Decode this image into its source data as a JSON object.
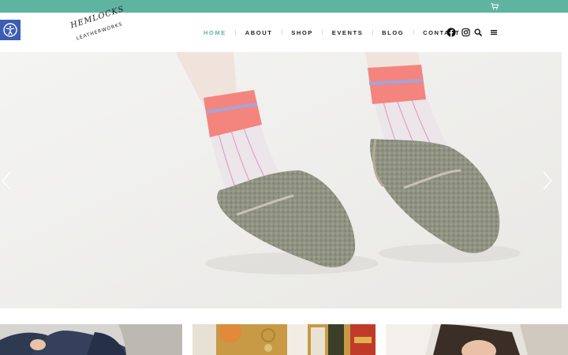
{
  "brand": {
    "logo_line1": "HEMLOCKS",
    "logo_line2": "LEATHERWORKS",
    "accent_color": "#5fb3a1",
    "a11y_color": "#3b5db5"
  },
  "nav": {
    "items": [
      {
        "label": "HOME",
        "active": true
      },
      {
        "label": "ABOUT",
        "active": false
      },
      {
        "label": "SHOP",
        "active": false
      },
      {
        "label": "EVENTS",
        "active": false
      },
      {
        "label": "BLOG",
        "active": false
      },
      {
        "label": "CONTACT",
        "active": false
      }
    ],
    "separator": "|"
  },
  "icons": {
    "cart": "cart-icon",
    "accessibility": "accessibility-icon",
    "facebook": "facebook-icon",
    "instagram": "instagram-icon",
    "search": "search-icon",
    "menu": "hamburger-menu-icon",
    "prev": "chevron-left-icon",
    "next": "chevron-right-icon"
  },
  "hero": {
    "image": "feet in pink striped socks and grey shearling slippers"
  },
  "thumbnails": [
    {
      "image": "person in denim jacket"
    },
    {
      "image": "jewelry and products on table"
    },
    {
      "image": "woman with dark hair"
    }
  ]
}
